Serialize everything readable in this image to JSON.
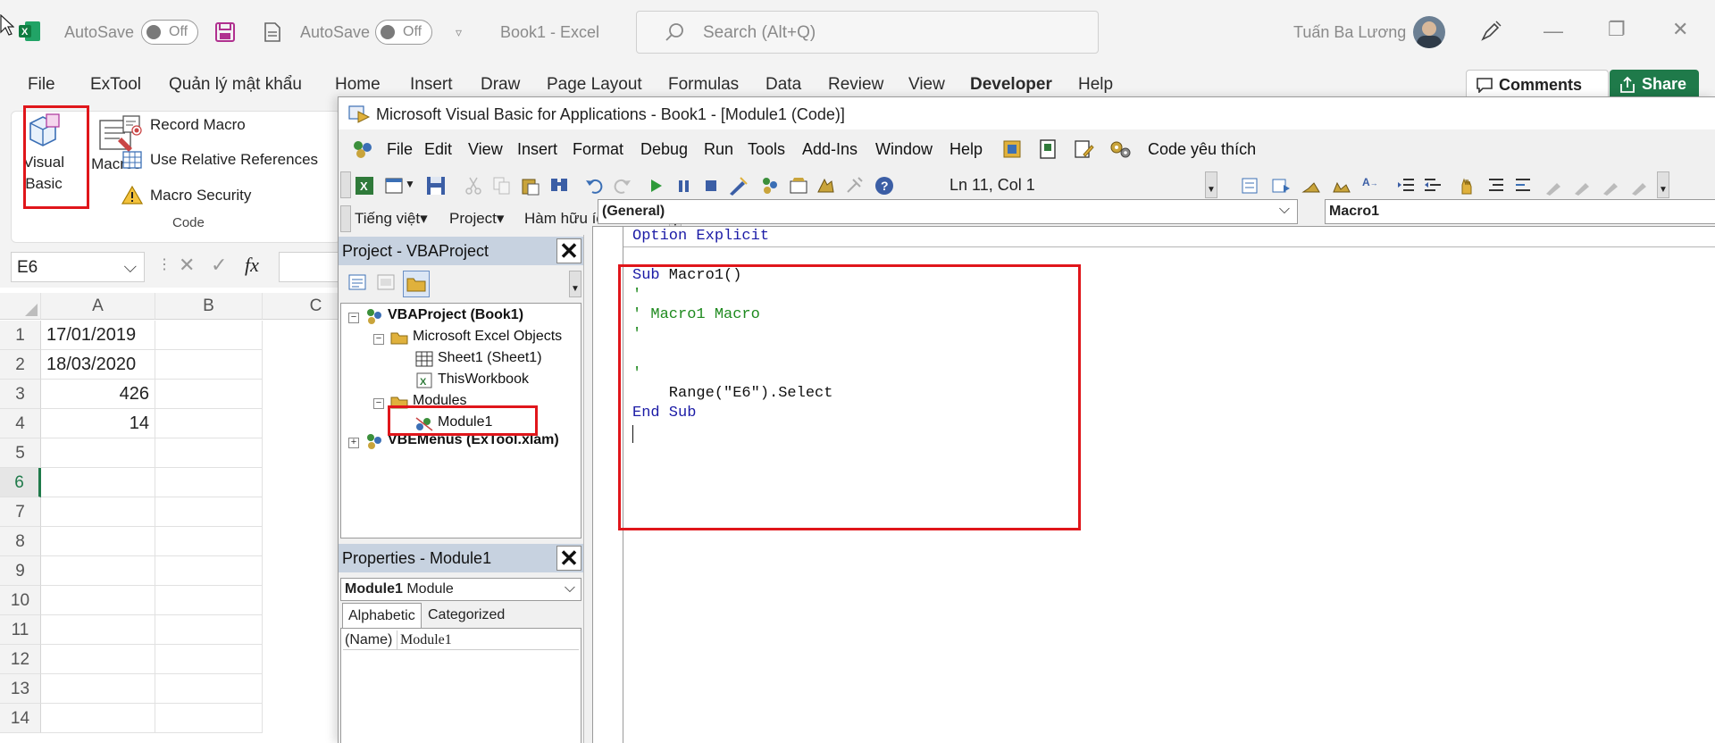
{
  "excel": {
    "autosave1": "AutoSave",
    "autosave1_state": "Off",
    "autosave2": "AutoSave",
    "autosave2_state": "Off",
    "doc_title": "Book1  -  Excel",
    "search_placeholder": "Search (Alt+Q)",
    "user_name": "Tuấn Ba Lương",
    "menu": [
      "File",
      "ExTool",
      "Quản lý mật khẩu",
      "Home",
      "Insert",
      "Draw",
      "Page Layout",
      "Formulas",
      "Data",
      "Review",
      "View",
      "Developer",
      "Help"
    ],
    "comments_label": "Comments",
    "share_label": "Share",
    "ribbon": {
      "visual_basic_line1": "Visual",
      "visual_basic_line2": "Basic",
      "macros": "Macros",
      "record_macro": "Record Macro",
      "use_relative": "Use Relative References",
      "macro_security": "Macro Security",
      "group_code": "Code"
    },
    "name_box": "E6",
    "fx": "fx",
    "columns": [
      "A",
      "B",
      "C"
    ],
    "rows": [
      "1",
      "2",
      "3",
      "4",
      "5",
      "6",
      "7",
      "8",
      "9",
      "10",
      "11",
      "12",
      "13",
      "14"
    ],
    "cells": {
      "a1": "17/01/2019",
      "a2": "18/03/2020",
      "a3": "426",
      "a4": "14"
    }
  },
  "vba": {
    "title": "Microsoft Visual Basic for Applications - Book1 - [Module1 (Code)]",
    "menu": [
      "File",
      "Edit",
      "View",
      "Insert",
      "Format",
      "Debug",
      "Run",
      "Tools",
      "Add-Ins",
      "Window",
      "Help"
    ],
    "menu_extra": "Code yêu thích",
    "status": "Ln 11, Col 1",
    "toolbar2": [
      "Tiếng việt",
      "Project",
      "Hàm hữu ích khác"
    ],
    "project_title": "Project - VBAProject",
    "tree": {
      "root": "VBAProject (Book1)",
      "excel_objects": "Microsoft Excel Objects",
      "sheet1": "Sheet1 (Sheet1)",
      "thisworkbook": "ThisWorkbook",
      "modules": "Modules",
      "module1": "Module1",
      "vbemenus": "VBEMenus (ExTool.xlam)"
    },
    "properties_title": "Properties - Module1",
    "prop_combo_bold": "Module1",
    "prop_combo_rest": " Module",
    "prop_tabs": [
      "Alphabetic",
      "Categorized"
    ],
    "prop_name_key": "(Name)",
    "prop_name_val": "Module1",
    "combo_general": "(General)",
    "combo_proc": "Macro1",
    "code": {
      "l1_kw": "Option Explicit",
      "l3_kw1": "Sub",
      "l3_tx": " Macro1()",
      "l4": "'",
      "l5": "' Macro1 Macro",
      "l6": "'",
      "l8": "'",
      "l9": "    Range(\"E6\").Select",
      "l10_kw": "End Sub"
    }
  }
}
